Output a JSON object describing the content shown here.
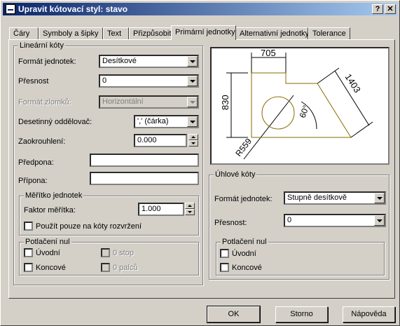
{
  "window": {
    "title": "Upravit kótovací styl: stavo",
    "help_btn": "?",
    "close_btn": "✕"
  },
  "tabs": [
    "Čáry",
    "Symboly a šipky",
    "Text",
    "Přizpůsobit",
    "Primární jednotky",
    "Alternativní jednotky",
    "Tolerance"
  ],
  "linear": {
    "title": "Lineární kóty",
    "format_label": "Formát jednotek:",
    "format_value": "Desítkové",
    "precision_label": "Přesnost",
    "precision_value": "0",
    "fraction_label": "Formát zlomků:",
    "fraction_value": "Horizontální",
    "decimal_label": "Desetinný oddělovač:",
    "decimal_value": "',' (čárka)",
    "round_label": "Zaokrouhlení:",
    "round_value": "0.000",
    "prefix_label": "Předpona:",
    "prefix_value": "",
    "suffix_label": "Přípona:",
    "suffix_value": ""
  },
  "scale": {
    "title": "Měřítko jednotek",
    "factor_label": "Faktor měřítka:",
    "factor_value": "1.000",
    "layout_only_label": "Použít pouze na kóty rozvržení"
  },
  "zero_linear": {
    "title": "Potlačení nul",
    "leading": "Úvodní",
    "trailing": "Koncové",
    "feet": "0 stop",
    "inches": "0 palců"
  },
  "angular": {
    "title": "Úhlové kóty",
    "format_label": "Formát jednotek:",
    "format_value": "Stupně desítkově",
    "precision_label": "Přesnost:",
    "precision_value": "0"
  },
  "zero_angular": {
    "title": "Potlačení nul",
    "leading": "Úvodní",
    "trailing": "Koncové"
  },
  "preview": {
    "dim_top": "705",
    "dim_left": "830",
    "dim_diag": "1403",
    "angle": "60°",
    "radius": "R559"
  },
  "buttons": {
    "ok": "OK",
    "cancel": "Storno",
    "help": "Nápověda"
  }
}
